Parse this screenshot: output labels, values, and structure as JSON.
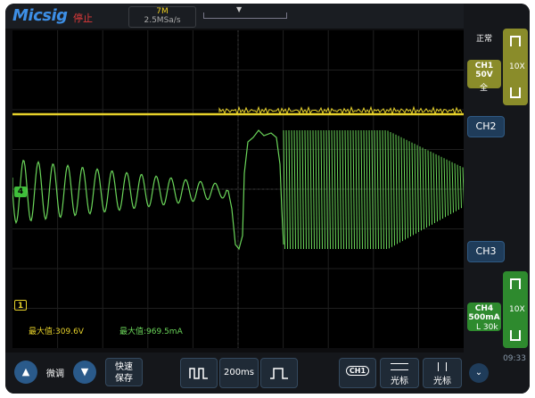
{
  "header": {
    "logo": "Micsig",
    "run_status": "停止",
    "memory_depth": "7M",
    "sample_rate": "2.5MSa/s"
  },
  "right_panel": {
    "trigger_mode": "正常",
    "ch1": {
      "label": "CH1",
      "scale": "50V",
      "probe": "10X",
      "coupling": "全"
    },
    "ch2_label": "CH2",
    "ch3_label": "CH3",
    "ch4": {
      "label": "CH4",
      "scale": "500mA",
      "probe": "10X",
      "filter": "L 30k"
    }
  },
  "screen": {
    "ch1_marker": "1",
    "ch4_marker": "4",
    "ch1_max_label": "最大值:309.6V",
    "ch4_max_label": "最大值:969.5mA",
    "ch1_color": "#e6d12a",
    "ch4_color": "#6bd65a"
  },
  "bottom": {
    "fine_label": "微调",
    "quick_save_line1": "快速",
    "quick_save_line2": "保存",
    "timebase": "200ms",
    "ch1_tag": "CH1",
    "cursor1_label": "光标",
    "cursor2_label": "光标",
    "clock": "09:33"
  }
}
